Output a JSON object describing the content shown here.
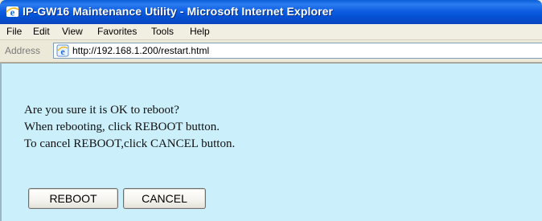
{
  "window": {
    "title": "IP-GW16 Maintenance Utility - Microsoft Internet Explorer",
    "title_bar_color": "#0a5fd8"
  },
  "menu": {
    "items": [
      "File",
      "Edit",
      "View",
      "Favorites",
      "Tools",
      "Help"
    ]
  },
  "address_bar": {
    "label": "Address",
    "url": "http://192.168.1.200/restart.html"
  },
  "content": {
    "background_color": "#ccf0fb",
    "lines": [
      "Are you sure it is OK to reboot?",
      "When rebooting, click REBOOT button.",
      "To cancel REBOOT,click CANCEL button."
    ],
    "buttons": {
      "reboot_label": "REBOOT",
      "cancel_label": "CANCEL"
    }
  },
  "icons": {
    "title_icon": "ie-icon",
    "address_page_icon": "ie-page-icon"
  }
}
